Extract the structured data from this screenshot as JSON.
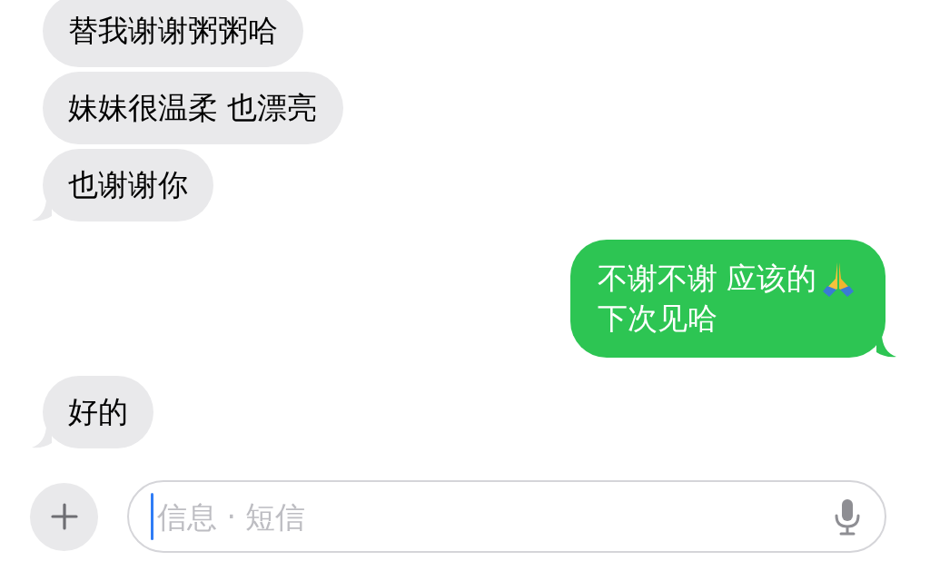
{
  "messages": [
    {
      "kind": "incoming",
      "lines": [
        "替我谢谢粥粥哈"
      ],
      "tail": false,
      "emoji": false
    },
    {
      "kind": "incoming",
      "lines": [
        "妹妹很温柔 也漂亮"
      ],
      "tail": false,
      "emoji": false
    },
    {
      "kind": "incoming",
      "lines": [
        "也谢谢你"
      ],
      "tail": true,
      "emoji": false
    },
    {
      "kind": "outgoing",
      "lines": [
        "不谢不谢 应该的",
        "下次见哈"
      ],
      "tail": true,
      "emoji": true
    },
    {
      "kind": "incoming",
      "lines": [
        "好的"
      ],
      "tail": true,
      "emoji": false
    }
  ],
  "composer": {
    "placeholder": "信息 · 短信"
  }
}
